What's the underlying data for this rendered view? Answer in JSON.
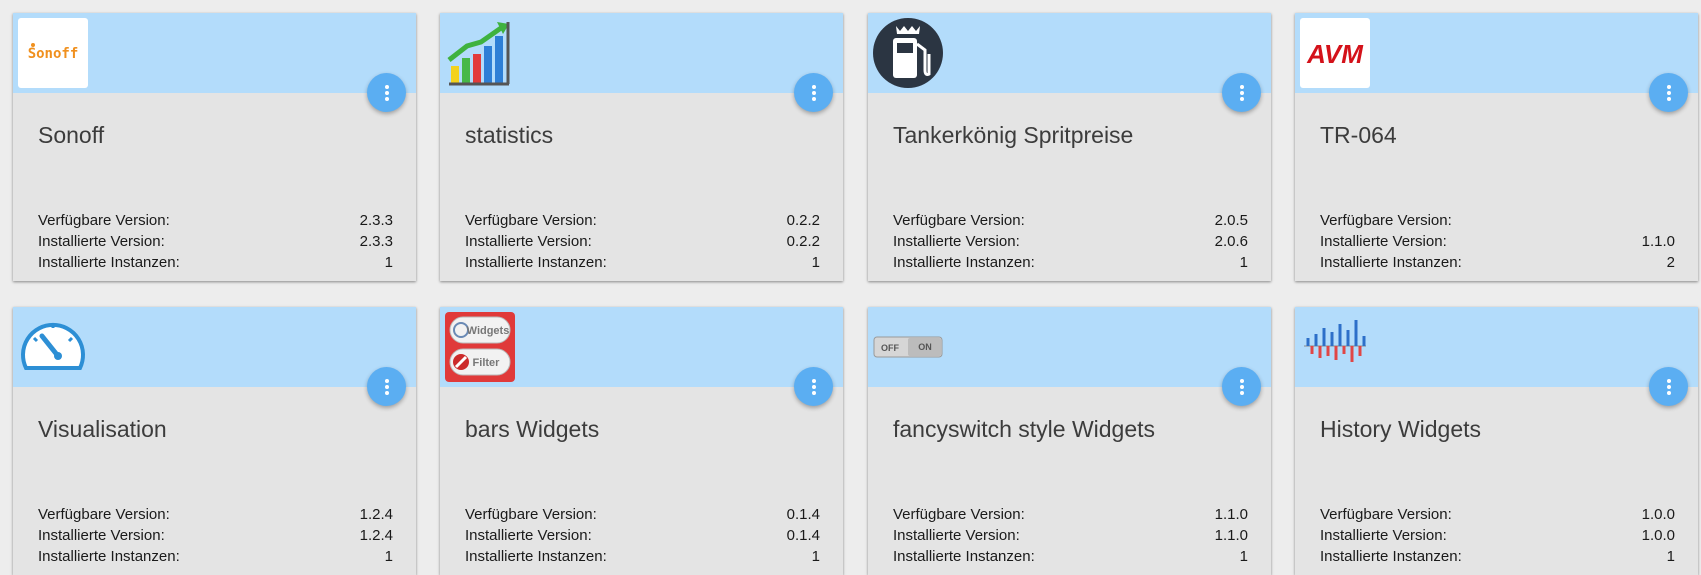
{
  "labels": {
    "available": "Verfügbare Version:",
    "installed": "Installierte Version:",
    "instances": "Installierte Instanzen:"
  },
  "colors": {
    "header": "#b3dcfb",
    "menu_button": "#5baef2",
    "card_bg": "#e4e4e4",
    "page_bg": "#ededed"
  },
  "adapters": [
    {
      "title": "Sonoff",
      "icon": "sonoff-logo-icon",
      "icon_text": "Sonoff",
      "available": "2.3.3",
      "installed": "2.3.3",
      "instances": "1"
    },
    {
      "title": "statistics",
      "icon": "statistics-chart-icon",
      "available": "0.2.2",
      "installed": "0.2.2",
      "instances": "1"
    },
    {
      "title": "Tankerkönig Spritpreise",
      "icon": "fuel-pump-icon",
      "available": "2.0.5",
      "installed": "2.0.6",
      "instances": "1"
    },
    {
      "title": "TR-064",
      "icon": "avm-logo-icon",
      "icon_text": "AVM",
      "available": "",
      "installed": "1.1.0",
      "instances": "2"
    },
    {
      "title": "Visualisation",
      "icon": "speedometer-icon",
      "available": "1.2.4",
      "installed": "1.2.4",
      "instances": "1"
    },
    {
      "title": "bars Widgets",
      "icon": "bars-widgets-icon",
      "icon_text_1": "Widgets",
      "icon_text_2": "Filter",
      "available": "0.1.4",
      "installed": "0.1.4",
      "instances": "1"
    },
    {
      "title": "fancyswitch style Widgets",
      "icon": "toggle-switch-icon",
      "icon_text_1": "OFF",
      "icon_text_2": "ON",
      "available": "1.1.0",
      "installed": "1.1.0",
      "instances": "1"
    },
    {
      "title": "History Widgets",
      "icon": "history-bars-icon",
      "available": "1.0.0",
      "installed": "1.0.0",
      "instances": "1"
    }
  ]
}
